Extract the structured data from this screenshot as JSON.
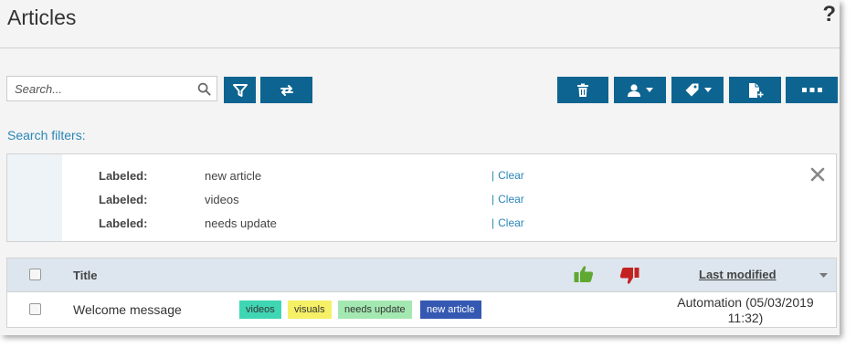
{
  "header": {
    "title": "Articles",
    "help_label": "?"
  },
  "toolbar": {
    "search_placeholder": "Search...",
    "icons": {
      "search": "search-icon",
      "filter": "filter-icon",
      "sync": "sync-icon",
      "delete": "trash-icon",
      "assign": "user-icon",
      "label": "tag-icon",
      "new": "new-document-icon",
      "more": "more-icon"
    }
  },
  "filters": {
    "label": "Search filters:",
    "rows": [
      {
        "key": "Labeled:",
        "value": "new article",
        "clear": "Clear"
      },
      {
        "key": "Labeled:",
        "value": "videos",
        "clear": "Clear"
      },
      {
        "key": "Labeled:",
        "value": "needs update",
        "clear": "Clear"
      }
    ]
  },
  "table": {
    "columns": {
      "title": "Title",
      "last_modified": "Last modified"
    },
    "rows": [
      {
        "title": "Welcome message",
        "tags": [
          {
            "label": "videos",
            "bg": "#3fd6b4",
            "fg": "#333333"
          },
          {
            "label": "visuals",
            "bg": "#f5f066",
            "fg": "#333333"
          },
          {
            "label": "needs update",
            "bg": "#a4e8b1",
            "fg": "#333333"
          },
          {
            "label": "new article",
            "bg": "#3559b2",
            "fg": "#ffffff"
          }
        ],
        "modified_line1": "Automation (05/03/2019",
        "modified_line2": "11:32)"
      }
    ]
  },
  "colors": {
    "accent": "#0d6490",
    "link": "#2a86b8",
    "thumb_up": "#5fa832",
    "thumb_down": "#c42121"
  }
}
